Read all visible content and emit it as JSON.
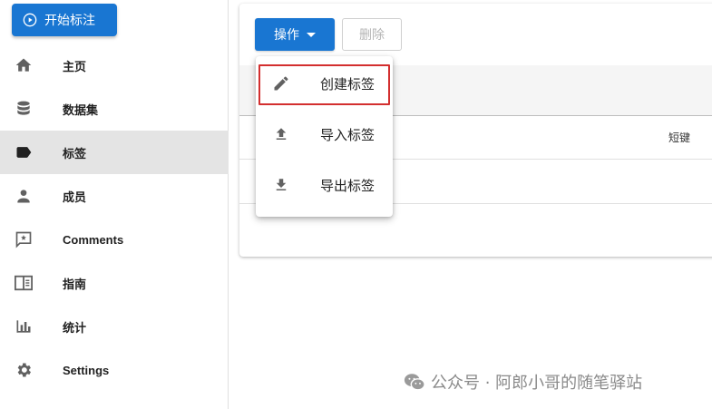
{
  "sidebar": {
    "start_button": "开始标注",
    "items": [
      {
        "label": "主页",
        "icon": "home-icon"
      },
      {
        "label": "数据集",
        "icon": "database-icon"
      },
      {
        "label": "标签",
        "icon": "label-icon",
        "active": true
      },
      {
        "label": "成员",
        "icon": "person-icon"
      },
      {
        "label": "Comments",
        "icon": "comment-icon"
      },
      {
        "label": "指南",
        "icon": "book-icon"
      },
      {
        "label": "统计",
        "icon": "bar-chart-icon"
      },
      {
        "label": "Settings",
        "icon": "gear-icon"
      }
    ]
  },
  "toolbar": {
    "action_label": "操作",
    "delete_label": "删除"
  },
  "menu": {
    "items": [
      {
        "label": "创建标签",
        "icon": "pencil-icon"
      },
      {
        "label": "导入标签",
        "icon": "upload-icon"
      },
      {
        "label": "导出标签",
        "icon": "download-icon"
      }
    ]
  },
  "table": {
    "shortcut_header": "短键"
  },
  "watermark": {
    "text": "公众号 · 阿郎小哥的随笔驿站"
  },
  "colors": {
    "primary": "#1976d2",
    "highlight_border": "#d32f2f",
    "active_nav_bg": "#e4e4e4"
  }
}
